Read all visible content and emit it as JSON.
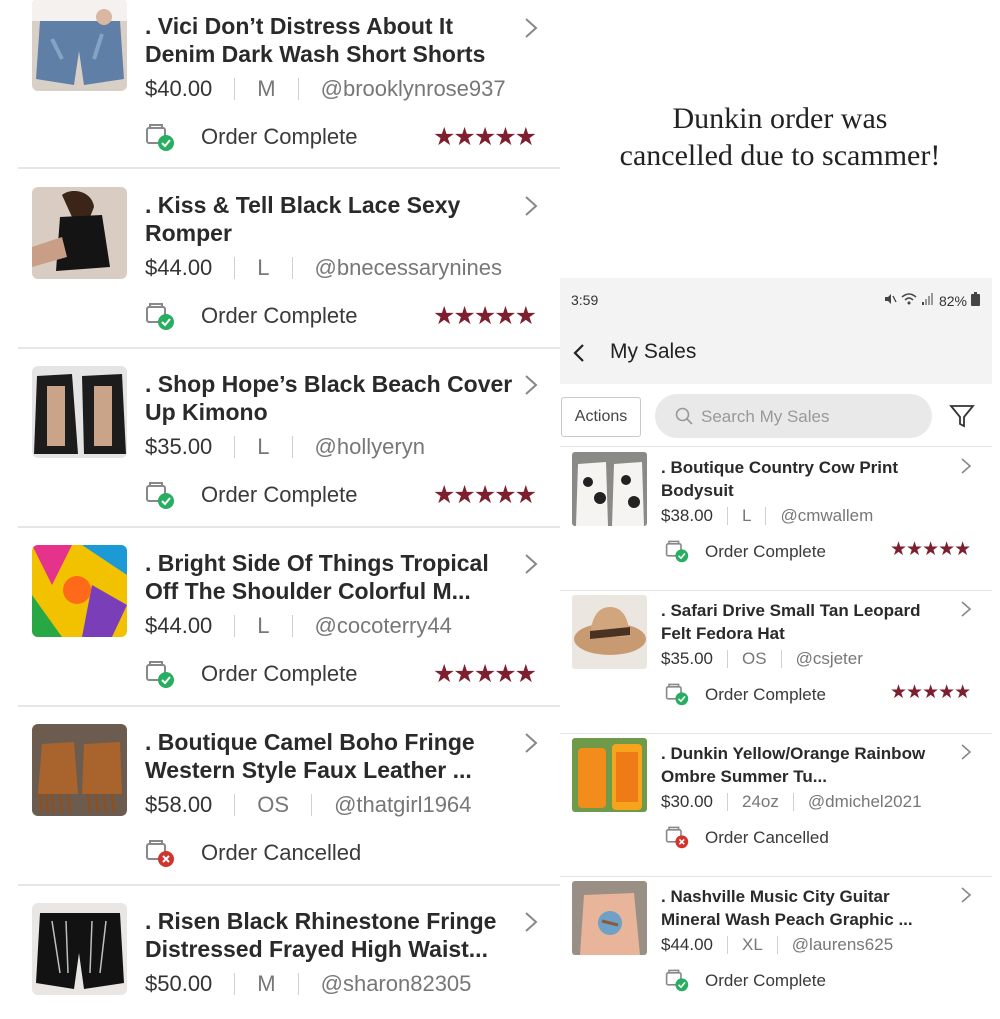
{
  "caption": {
    "line1": "Dunkin order was",
    "line2": "cancelled due to scammer!"
  },
  "left_list": [
    {
      "title": ". Vici Don’t Distress About It Denim Dark Wash Short Shorts",
      "price": "$40.00",
      "size": "M",
      "user": "@brooklynrose937",
      "status": "Order Complete",
      "complete": true,
      "stars": "★★★★★"
    },
    {
      "title": ". Kiss & Tell Black Lace Sexy Romper",
      "price": "$44.00",
      "size": "L",
      "user": "@bnecessarynines",
      "status": "Order Complete",
      "complete": true,
      "stars": "★★★★★"
    },
    {
      "title": ". Shop Hope’s Black Beach Cover Up Kimono",
      "price": "$35.00",
      "size": "L",
      "user": "@hollyeryn",
      "status": "Order Complete",
      "complete": true,
      "stars": "★★★★★"
    },
    {
      "title": ". Bright Side Of Things Tropical Off The Shoulder Colorful M...",
      "price": "$44.00",
      "size": "L",
      "user": "@cocoterry44",
      "status": "Order Complete",
      "complete": true,
      "stars": "★★★★★"
    },
    {
      "title": ". Boutique Camel Boho Fringe Western Style Faux Leather ...",
      "price": "$58.00",
      "size": "OS",
      "user": "@thatgirl1964",
      "status": "Order Cancelled",
      "complete": false,
      "stars": ""
    },
    {
      "title": ". Risen Black Rhinestone Fringe Distressed Frayed High Waist...",
      "price": "$50.00",
      "size": "M",
      "user": "@sharon82305",
      "status": "",
      "complete": true,
      "stars": ""
    }
  ],
  "phone": {
    "statusbar": {
      "time": "3:59",
      "battery": "82%"
    },
    "header": {
      "title": "My Sales"
    },
    "toolbar": {
      "actions_label": "Actions",
      "search_placeholder": "Search My Sales"
    },
    "items": [
      {
        "title": ". Boutique Country Cow Print Bodysuit",
        "price": "$38.00",
        "size": "L",
        "user": "@cmwallem",
        "status": "Order Complete",
        "complete": true,
        "stars": "★★★★★"
      },
      {
        "title": ". Safari Drive Small Tan Leopard Felt Fedora Hat",
        "price": "$35.00",
        "size": "OS",
        "user": "@csjeter",
        "status": "Order Complete",
        "complete": true,
        "stars": "★★★★★"
      },
      {
        "title": ". Dunkin Yellow/Orange Rainbow Ombre Summer Tu...",
        "price": "$30.00",
        "size": "24oz",
        "user": "@dmichel2021",
        "status": "Order Cancelled",
        "complete": false,
        "stars": ""
      },
      {
        "title": ". Nashville Music City Guitar Mineral Wash Peach Graphic ...",
        "price": "$44.00",
        "size": "XL",
        "user": "@laurens625",
        "status": "Order Complete",
        "complete": true,
        "stars": ""
      }
    ]
  },
  "colors": {
    "star": "#7d1f2e",
    "complete_badge": "#27ae60",
    "cancel_badge": "#d0342c"
  }
}
